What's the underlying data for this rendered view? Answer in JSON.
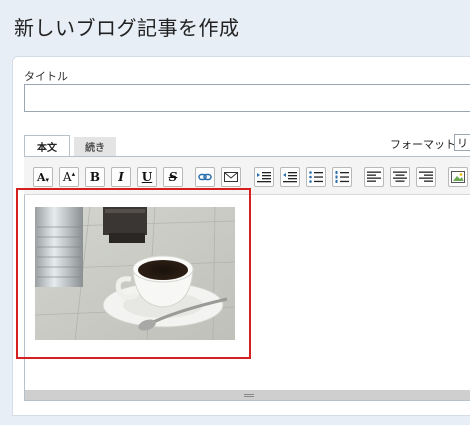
{
  "page": {
    "title": "新しいブログ記事を作成"
  },
  "form": {
    "title_label": "タイトル",
    "title_value": "",
    "title_placeholder": ""
  },
  "tabs": [
    {
      "label": "本文",
      "active": true
    },
    {
      "label": "続き",
      "active": false
    }
  ],
  "format": {
    "label": "フォーマット:",
    "selected": "リ"
  },
  "toolbar": {
    "font_size_down": "A",
    "font_size_up": "A",
    "bold": "B",
    "italic": "I",
    "underline": "U",
    "strike": "S",
    "buttons": [
      "font-size-decrease-icon",
      "font-size-increase-icon",
      "bold-icon",
      "italic-icon",
      "underline-icon",
      "strikethrough-icon",
      "link-icon",
      "email-icon",
      "indent-icon",
      "outdent-icon",
      "bullet-list-icon",
      "numbered-list-icon",
      "align-left-icon",
      "align-center-icon",
      "align-right-icon",
      "insert-image-icon"
    ]
  },
  "colors": {
    "selection_border": "#d42020",
    "page_background": "#e8eef6"
  }
}
